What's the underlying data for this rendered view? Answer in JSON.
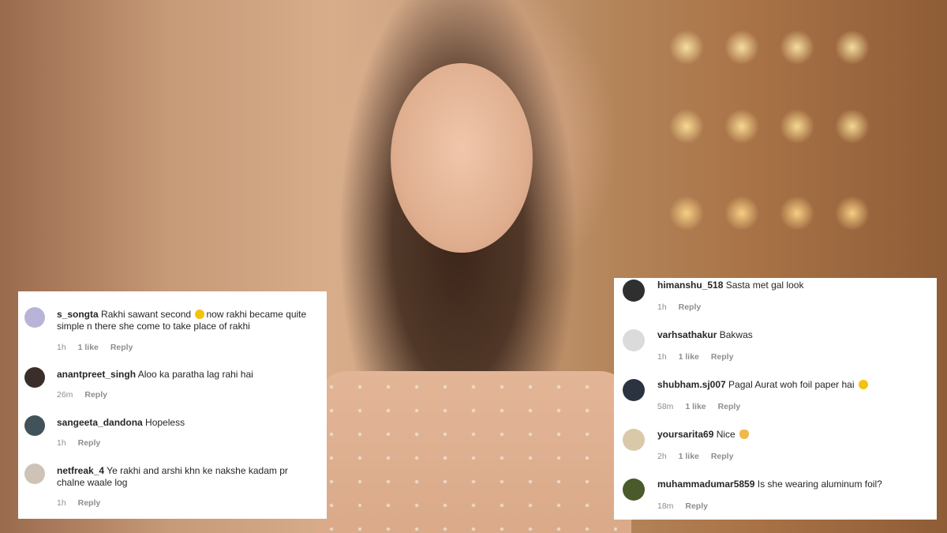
{
  "left_panel": {
    "comments": [
      {
        "username": "s_songta",
        "text_before_emoji": "Rakhi sawant second ",
        "emoji": "laughing-face",
        "text_after_emoji": "now rakhi became quite simple n there she come to take place of rakhi",
        "time": "1h",
        "likes": "1 like",
        "reply": "Reply",
        "avatar_color": "#b8b4d8"
      },
      {
        "username": "anantpreet_singh",
        "text": "Aloo ka paratha lag rahi hai",
        "time": "26m",
        "reply": "Reply",
        "avatar_color": "#3a2e2a"
      },
      {
        "username": "sangeeta_dandona",
        "text": "Hopeless",
        "time": "1h",
        "reply": "Reply",
        "avatar_color": "#41525a"
      },
      {
        "username": "netfreak_4",
        "text": "Ye rakhi and arshi khn ke nakshe kadam pr chalne waale log",
        "time": "1h",
        "reply": "Reply",
        "avatar_color": "#cfc3b8"
      }
    ]
  },
  "right_panel": {
    "comments": [
      {
        "username": "himanshu_518",
        "text": "Sasta met gal look",
        "time": "1h",
        "reply": "Reply",
        "avatar_color": "#2f2f2f"
      },
      {
        "username": "varhsathakur",
        "text": "Bakwas",
        "time": "1h",
        "likes": "1 like",
        "reply": "Reply",
        "avatar_color": "#dbdbdb"
      },
      {
        "username": "shubham.sj007",
        "text": "Pagal Aurat woh foil paper hai",
        "emoji": "laughing-face",
        "time": "58m",
        "likes": "1 like",
        "reply": "Reply",
        "avatar_color": "#2b3340"
      },
      {
        "username": "yoursarita69",
        "text": "Nice",
        "emoji": "ok-hand",
        "time": "2h",
        "likes": "1 like",
        "reply": "Reply",
        "avatar_color": "#d9c9a8"
      },
      {
        "username": "muhammadumar5859",
        "text": "Is she wearing aluminum foil?",
        "time": "18m",
        "reply": "Reply",
        "avatar_color": "#4a5a2a"
      }
    ]
  }
}
